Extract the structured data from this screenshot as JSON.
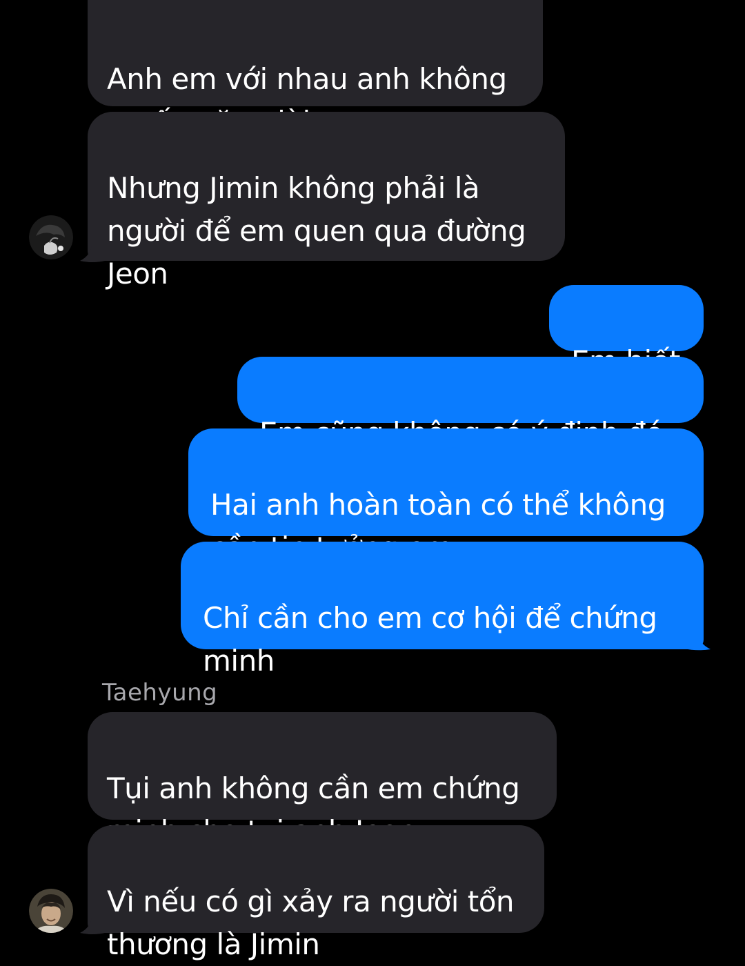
{
  "thread": {
    "messages": [
      {
        "id": "m1",
        "from": "incoming",
        "text": "Anh em với nhau anh không\nmuốn nặng lời"
      },
      {
        "id": "m2",
        "from": "incoming",
        "text": "Nhưng Jimin không phải là\nngười để em quen qua đường\nJeon"
      },
      {
        "id": "m3",
        "from": "outgoing",
        "text": "Em biết"
      },
      {
        "id": "m4",
        "from": "outgoing",
        "text": "Em cũng không có ý định đó"
      },
      {
        "id": "m5",
        "from": "outgoing",
        "text": "Hai anh hoàn toàn có thể không\ncần tin tưởng em"
      },
      {
        "id": "m6",
        "from": "outgoing",
        "text": "Chỉ cần cho em cơ hội để chứng\nminh"
      },
      {
        "id": "m7",
        "from": "incoming",
        "text": "Tụi anh không cần em chứng\nminh cho tụi anh Jeon"
      },
      {
        "id": "m8",
        "from": "incoming",
        "text": "Vì nếu có gì xảy ra người tổn\nthương là Jimin"
      }
    ],
    "sender_name": "Taehyung"
  },
  "colors": {
    "background": "#000000",
    "incoming_bubble": "#26252a",
    "outgoing_bubble": "#0a7cff",
    "text": "#ffffff",
    "sender_name": "#a8a8ad"
  }
}
